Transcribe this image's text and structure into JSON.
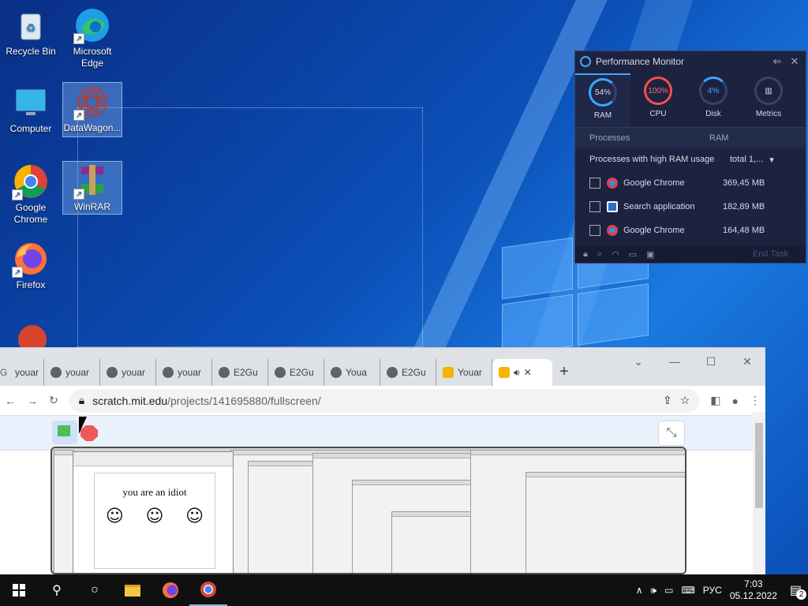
{
  "desktop": {
    "icons": [
      {
        "label": "Recycle Bin",
        "icon": "recycle-bin-icon"
      },
      {
        "label": "Microsoft Edge",
        "icon": "edge-icon"
      },
      {
        "label": "Computer",
        "icon": "computer-icon"
      },
      {
        "label": "DataWagon...",
        "icon": "datawagon-icon"
      },
      {
        "label": "Google Chrome",
        "icon": "chrome-icon"
      },
      {
        "label": "WinRAR",
        "icon": "winrar-icon"
      },
      {
        "label": "Firefox",
        "icon": "firefox-icon"
      }
    ]
  },
  "perf_monitor": {
    "title": "Performance Monitor",
    "gauges": [
      {
        "value": "54%",
        "label": "RAM",
        "color": "#3da7ff"
      },
      {
        "value": "100%",
        "label": "CPU",
        "color": "#ff4b4b"
      },
      {
        "value": "4%",
        "label": "Disk",
        "color": "#3da7ff"
      },
      {
        "value": "",
        "label": "Metrics",
        "color": "#9aa3c0"
      }
    ],
    "columns": {
      "processes": "Processes",
      "ram": "RAM"
    },
    "filter": {
      "label": "Processes with high RAM usage",
      "value": "total 1,..."
    },
    "rows": [
      {
        "name": "Google Chrome",
        "ram": "369,45 MB"
      },
      {
        "name": "Search application",
        "ram": "182,89 MB"
      },
      {
        "name": "Google Chrome",
        "ram": "164,48 MB"
      }
    ],
    "end_task": "End Task"
  },
  "browser": {
    "tabs": [
      {
        "title": "youar"
      },
      {
        "title": "youar"
      },
      {
        "title": "youar"
      },
      {
        "title": "youar"
      },
      {
        "title": "E2Gu"
      },
      {
        "title": "E2Gu"
      },
      {
        "title": "Youa"
      },
      {
        "title": "E2Gu"
      },
      {
        "title": "Youar"
      }
    ],
    "url_domain": "scratch.mit.edu",
    "url_path": "/projects/141695880/fullscreen/",
    "stage_text": "you are an idiot",
    "faces": [
      "☺",
      "☺",
      "☺"
    ]
  },
  "taskbar": {
    "language": "РУС",
    "time": "7:03",
    "date": "05.12.2022",
    "notifications": "2"
  }
}
